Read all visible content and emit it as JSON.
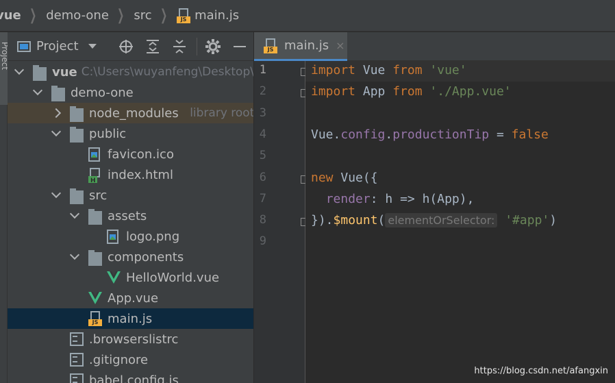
{
  "breadcrumb": {
    "items": [
      "vue",
      "demo-one",
      "src",
      "main.js"
    ]
  },
  "stripe": {
    "label": "Project"
  },
  "project_panel": {
    "title": "Project",
    "tools": [
      "target-icon",
      "expand-all-icon",
      "collapse-all-icon",
      "gear-icon",
      "minimize-icon"
    ],
    "tree": [
      {
        "name": "vue",
        "hint": "C:\\Users\\wuyanfeng\\Desktop\\",
        "type": "folder",
        "depth": 0,
        "expanded": true,
        "bold": true
      },
      {
        "name": "demo-one",
        "type": "folder",
        "depth": 1,
        "expanded": true
      },
      {
        "name": "node_modules",
        "hint": "library root",
        "type": "folder",
        "depth": 2,
        "expanded": false,
        "excluded": true
      },
      {
        "name": "public",
        "type": "folder",
        "depth": 2,
        "expanded": true
      },
      {
        "name": "favicon.ico",
        "type": "image",
        "depth": 3
      },
      {
        "name": "index.html",
        "type": "html",
        "depth": 3
      },
      {
        "name": "src",
        "type": "folder",
        "depth": 2,
        "expanded": true
      },
      {
        "name": "assets",
        "type": "folder",
        "depth": 3,
        "expanded": true
      },
      {
        "name": "logo.png",
        "type": "image",
        "depth": 4
      },
      {
        "name": "components",
        "type": "folder",
        "depth": 3,
        "expanded": true
      },
      {
        "name": "HelloWorld.vue",
        "type": "vue",
        "depth": 4
      },
      {
        "name": "App.vue",
        "type": "vue",
        "depth": 3
      },
      {
        "name": "main.js",
        "type": "js",
        "depth": 3,
        "selected": true
      },
      {
        "name": ".browserslistrc",
        "type": "text",
        "depth": 2
      },
      {
        "name": ".gitignore",
        "type": "text",
        "depth": 2
      },
      {
        "name": "babel.config.js",
        "type": "text",
        "depth": 2
      }
    ]
  },
  "editor": {
    "tab_label": "main.js",
    "tab_close": "×",
    "line_numbers": [
      "1",
      "2",
      "3",
      "4",
      "5",
      "6",
      "7",
      "8",
      "9"
    ],
    "lines": [
      [
        [
          "kw",
          "import"
        ],
        [
          "",
          " Vue "
        ],
        [
          "kw",
          "from"
        ],
        [
          "",
          " "
        ],
        [
          "str",
          "'vue'"
        ]
      ],
      [
        [
          "kw",
          "import"
        ],
        [
          "",
          " App "
        ],
        [
          "kw",
          "from"
        ],
        [
          "",
          " "
        ],
        [
          "str",
          "'./App.vue'"
        ]
      ],
      [],
      [
        [
          "",
          "Vue."
        ],
        [
          "prop",
          "config"
        ],
        [
          "",
          "."
        ],
        [
          "prop",
          "productionTip"
        ],
        [
          "",
          " = "
        ],
        [
          "kw",
          "false"
        ]
      ],
      [],
      [
        [
          "kw",
          "new"
        ],
        [
          "",
          " Vue({"
        ]
      ],
      [
        [
          "",
          "  "
        ],
        [
          "prop",
          "render"
        ],
        [
          "",
          ": h => h(App),"
        ]
      ],
      [
        [
          "",
          "})."
        ],
        [
          "fn",
          "$mount"
        ],
        [
          "",
          "("
        ],
        [
          "hint",
          "elementOrSelector:"
        ],
        [
          "",
          " "
        ],
        [
          "str",
          "'#app'"
        ],
        [
          "",
          ")"
        ]
      ],
      []
    ]
  },
  "watermark": "https://blog.csdn.net/afangxin"
}
